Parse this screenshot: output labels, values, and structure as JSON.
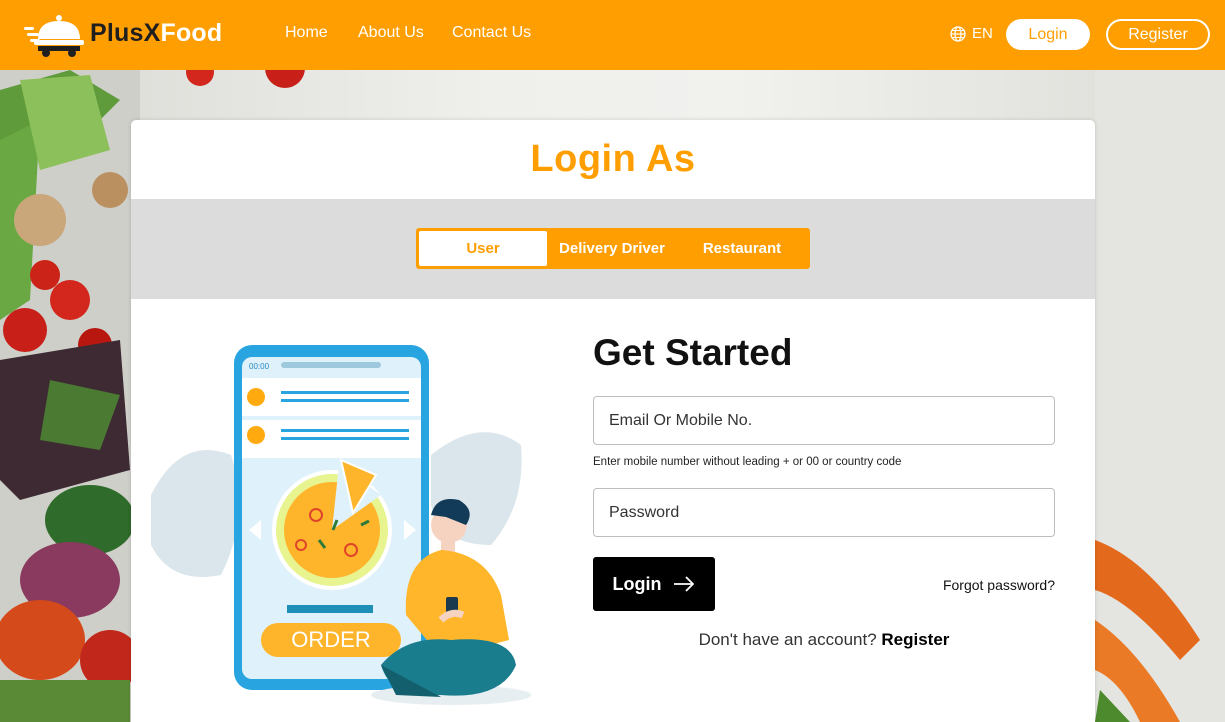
{
  "header": {
    "brand_part1": "PlusX",
    "brand_part2": "Food",
    "nav": [
      "Home",
      "About Us",
      "Contact Us"
    ],
    "language": "EN",
    "login_label": "Login",
    "register_label": "Register"
  },
  "card": {
    "title": "Login As",
    "tabs": [
      "User",
      "Delivery Driver",
      "Restaurant"
    ],
    "active_tab": "User",
    "heading": "Get Started",
    "email_placeholder": "Email Or Mobile No.",
    "email_hint": "Enter mobile number without leading + or 00 or country code",
    "password_placeholder": "Password",
    "login_button": "Login",
    "forgot_password": "Forgot password?",
    "no_account_text": "Don't have an account?",
    "register_link": "Register"
  },
  "illustration": {
    "status_time": "00:00",
    "order_label": "ORDER"
  },
  "colors": {
    "brand_orange": "#ff9e00",
    "dark": "#000000",
    "tab_bar_gray": "#dcdcdc"
  },
  "icons": [
    "food-cloche-logo-icon",
    "globe-icon",
    "arrow-right-icon"
  ]
}
